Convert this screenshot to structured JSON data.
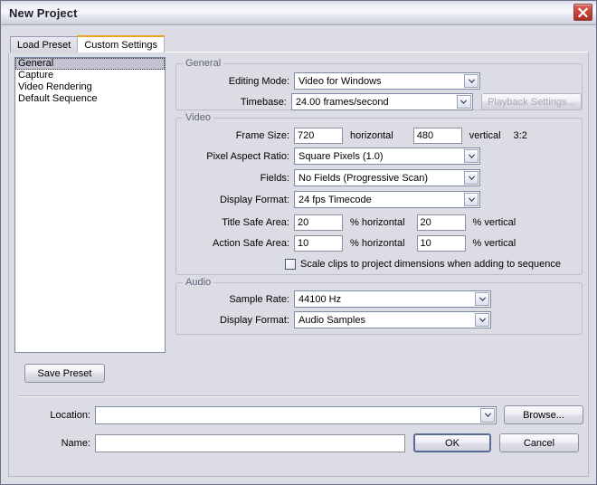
{
  "window": {
    "title": "New Project",
    "close_label": "close-icon"
  },
  "tabs": [
    {
      "label": "Load Preset",
      "active": false
    },
    {
      "label": "Custom Settings",
      "active": true
    }
  ],
  "categories": [
    {
      "label": "General",
      "selected": true
    },
    {
      "label": "Capture",
      "selected": false
    },
    {
      "label": "Video Rendering",
      "selected": false
    },
    {
      "label": "Default Sequence",
      "selected": false
    }
  ],
  "groups": {
    "general": {
      "title": "General",
      "editing_mode_label": "Editing Mode:",
      "editing_mode_value": "Video for Windows",
      "timebase_label": "Timebase:",
      "timebase_value": "24.00 frames/second",
      "playback_settings_button": "Playback Settings..."
    },
    "video": {
      "title": "Video",
      "frame_size_label": "Frame Size:",
      "frame_size_horizontal": "720",
      "frame_size_horizontal_unit": "horizontal",
      "frame_size_vertical": "480",
      "frame_size_vertical_unit": "vertical",
      "aspect_ratio_text": "3:2",
      "pixel_aspect_label": "Pixel Aspect Ratio:",
      "pixel_aspect_value": "Square Pixels (1.0)",
      "fields_label": "Fields:",
      "fields_value": "No Fields (Progressive Scan)",
      "display_format_label": "Display Format:",
      "display_format_value": "24 fps Timecode",
      "title_safe_label": "Title Safe Area:",
      "title_safe_horizontal": "20",
      "title_safe_horizontal_unit": "% horizontal",
      "title_safe_vertical": "20",
      "title_safe_vertical_unit": "% vertical",
      "action_safe_label": "Action Safe Area:",
      "action_safe_horizontal": "10",
      "action_safe_horizontal_unit": "% horizontal",
      "action_safe_vertical": "10",
      "action_safe_vertical_unit": "% vertical",
      "scale_clips_label": "Scale clips to project dimensions when adding to sequence",
      "scale_clips_checked": false
    },
    "audio": {
      "title": "Audio",
      "sample_rate_label": "Sample Rate:",
      "sample_rate_value": "44100 Hz",
      "display_format_label": "Display Format:",
      "display_format_value": "Audio Samples"
    }
  },
  "footer": {
    "save_preset_button": "Save Preset",
    "location_label": "Location:",
    "location_value": "",
    "browse_button": "Browse...",
    "name_label": "Name:",
    "name_value": "",
    "ok_button": "OK",
    "cancel_button": "Cancel"
  },
  "colors": {
    "dialog_face": "#dcdce4",
    "active_tab_accent": "#f0a024",
    "close_button": "#c8453c",
    "group_title": "#60627a",
    "selection": "#c3c3d1"
  }
}
